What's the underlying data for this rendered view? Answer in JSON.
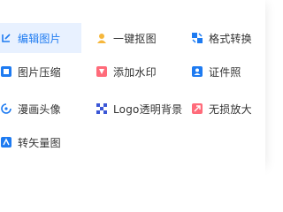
{
  "menu": {
    "items": [
      {
        "label": "编辑图片",
        "icon": "edit-image-icon",
        "active": true
      },
      {
        "label": "一键抠图",
        "icon": "cutout-icon"
      },
      {
        "label": "格式转换",
        "icon": "format-convert-icon"
      },
      {
        "label": "图片压缩",
        "icon": "compress-icon"
      },
      {
        "label": "添加水印",
        "icon": "watermark-icon"
      },
      {
        "label": "证件照",
        "icon": "id-photo-icon"
      },
      {
        "label": "漫画头像",
        "icon": "cartoon-avatar-icon"
      },
      {
        "label": "Logo透明背景",
        "icon": "transparent-logo-icon"
      },
      {
        "label": "无损放大",
        "icon": "lossless-enlarge-icon"
      },
      {
        "label": "转矢量图",
        "icon": "vectorize-icon"
      }
    ]
  },
  "colors": {
    "accent": "#1e7bf1",
    "active_bg": "#e8f1ff",
    "pink": "#ff6b7a",
    "yellow": "#f6b73c",
    "text": "#333333"
  }
}
